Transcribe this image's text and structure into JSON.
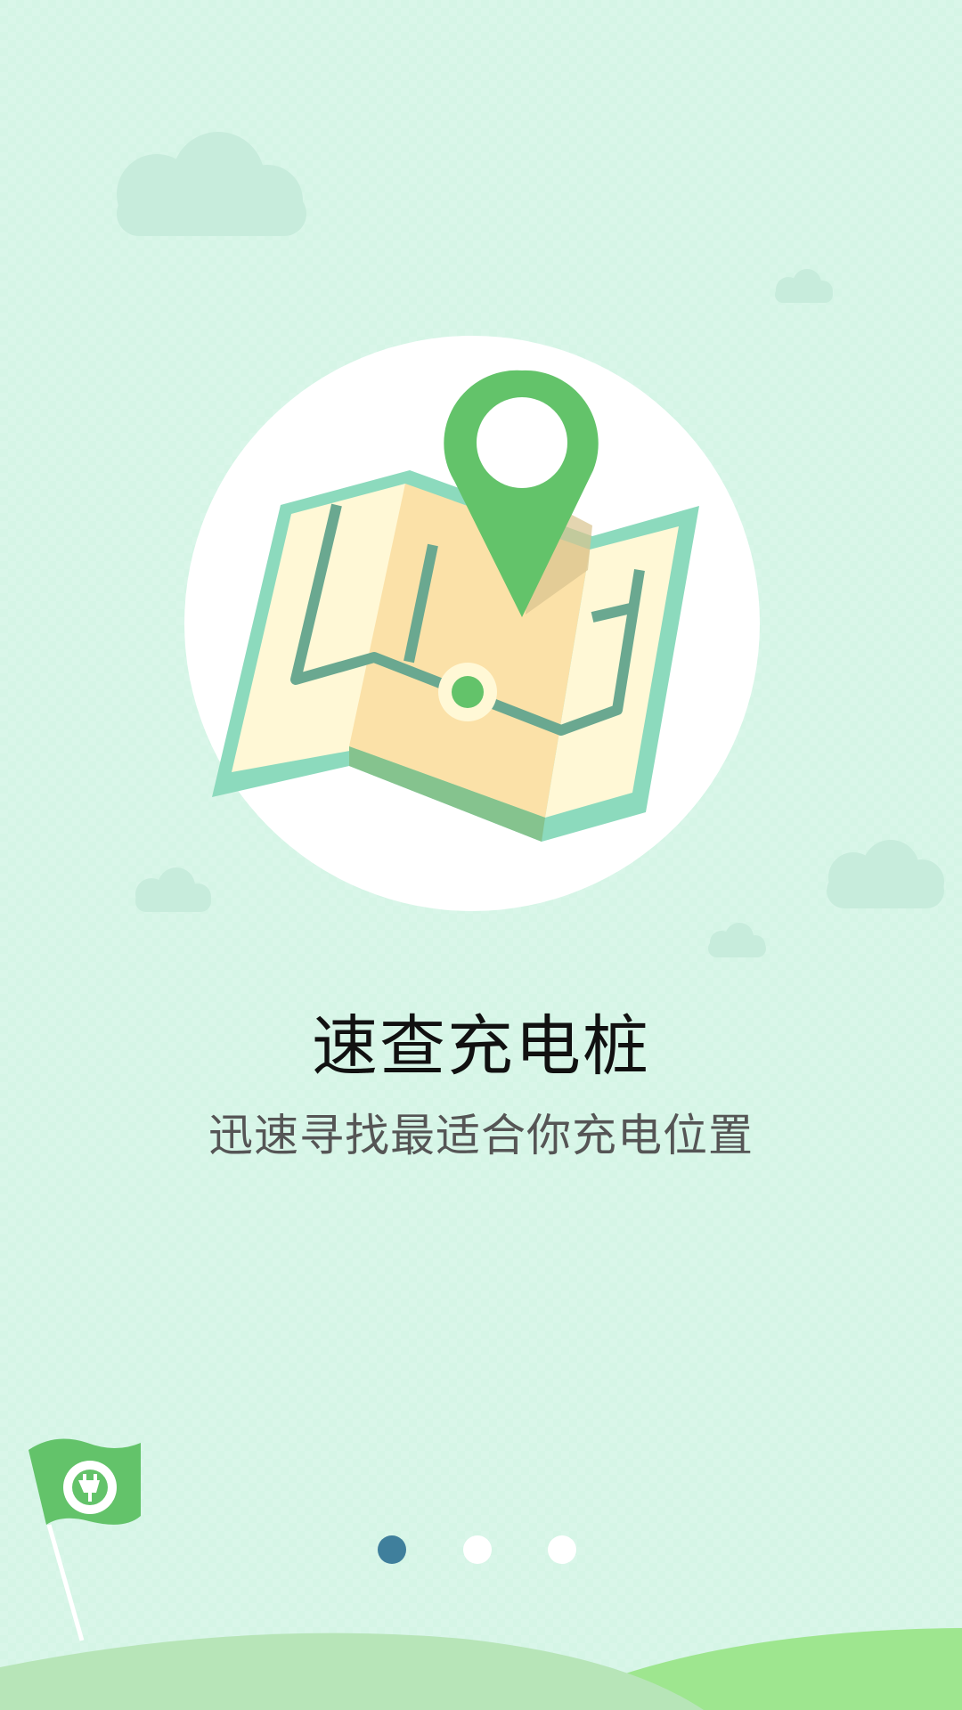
{
  "guide": {
    "title": "速查充电桩",
    "subtitle": "迅速寻找最适合你充电位置",
    "current_page": 1,
    "total_pages": 3,
    "pages": [
      {
        "index": 1,
        "active": true
      },
      {
        "index": 2,
        "active": false
      },
      {
        "index": 3,
        "active": false
      }
    ]
  },
  "colors": {
    "background": "#d5f5e6",
    "brand_green": "#63c36a",
    "map_frame": "#8cdabd",
    "route": "#6aa890",
    "active_dot": "#3f7f9c",
    "hill_light": "#b7e5b8",
    "hill_bright": "#9ee68f"
  },
  "icons": {
    "map": "folded-map-icon",
    "pin": "location-pin-icon",
    "flag": "brand-flag-icon",
    "logo": "charging-plug-logo-icon"
  }
}
